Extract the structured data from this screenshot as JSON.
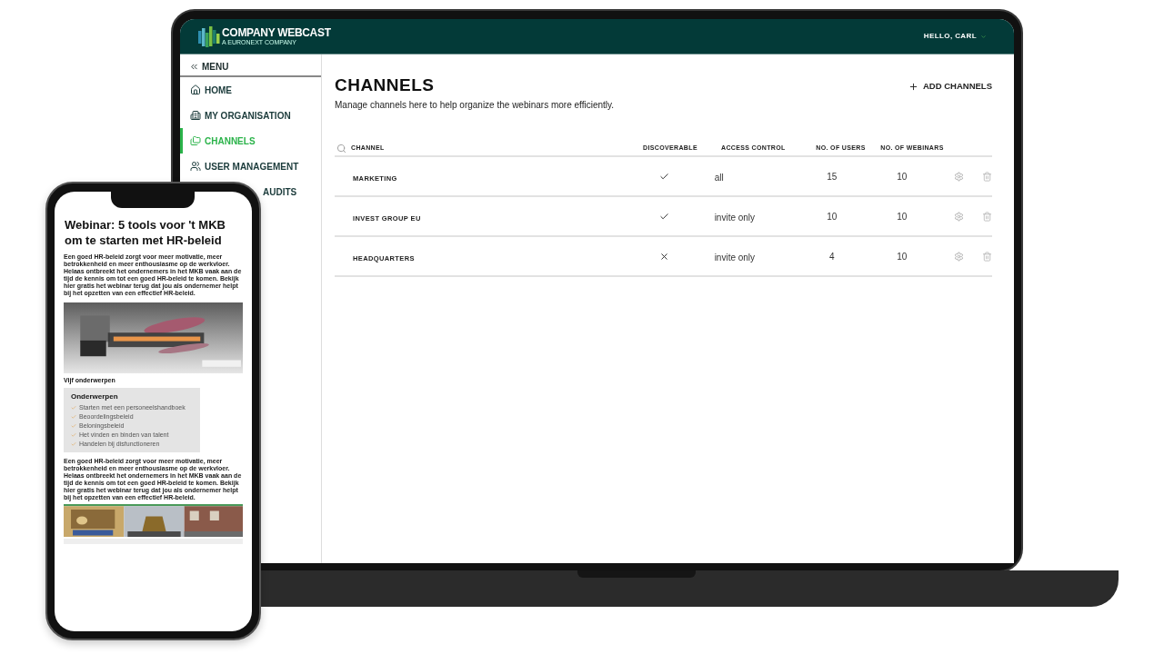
{
  "laptop": {
    "header": {
      "brand": "COMPANY WEBCAST",
      "brand_tagline": "A EURONEXT COMPANY",
      "user_menu": "HELLO, CARL"
    },
    "sidebar": {
      "menu_label": "MENU",
      "items": [
        {
          "label": "HOME",
          "selected": false
        },
        {
          "label": "MY ORGANISATION",
          "selected": false
        },
        {
          "label": "CHANNELS",
          "selected": true
        },
        {
          "label": "USER MANAGEMENT",
          "selected": false
        },
        {
          "label": "AUDITS",
          "selected": false
        }
      ]
    },
    "page": {
      "title": "CHANNELS",
      "description": "Manage channels here to help organize the webinars more efficiently.",
      "add_button": "ADD CHANNELS",
      "table": {
        "columns": [
          "CHANNEL",
          "DISCOVERABLE",
          "ACCESS CONTROL",
          "NO. OF USERS",
          "NO. OF WEBINARS"
        ],
        "rows": [
          {
            "channel": "MARKETING",
            "discoverable": true,
            "access_control": "all",
            "users": "15",
            "webinars": "10"
          },
          {
            "channel": "INVEST GROUP EU",
            "discoverable": true,
            "access_control": "invite only",
            "users": "10",
            "webinars": "10"
          },
          {
            "channel": "HEADQUARTERS",
            "discoverable": false,
            "access_control": "invite only",
            "users": "4",
            "webinars": "10"
          }
        ]
      }
    }
  },
  "phone": {
    "title": "Webinar: 5 tools voor 't MKB om te starten met HR-beleid",
    "intro": "Een goed HR-beleid zorgt voor meer motivatie, meer betrokkenheid en meer enthousiasme op de werkvloer. Helaas ontbreekt het ondernemers in het MKB vaak aan de tijd de kennis om tot een goed HR-beleid te komen. Bekijk hier gratis het webinar terug dat jou als ondernemer helpt bij het opzetten van een effectief HR-beleid.",
    "section_label": "Vijf onderwerpen",
    "topics": {
      "title": "Onderwerpen",
      "items": [
        "Starten met een personeelshandboek",
        "Beoordelingsbeleid",
        "Beloningsbeleid",
        "Het vinden en binden van talent",
        "Handelen bij disfunctioneren"
      ]
    },
    "body": "Een goed HR-beleid zorgt voor meer motivatie, meer betrokkenheid en meer enthousiasme op de werkvloer. Helaas ontbreekt het ondernemers in het MKB vaak aan de tijd de kennis om tot een goed HR-beleid te komen. Bekijk hier gratis het webinar terug dat jou als ondernemer helpt bij het opzetten van een effectief HR-beleid."
  }
}
